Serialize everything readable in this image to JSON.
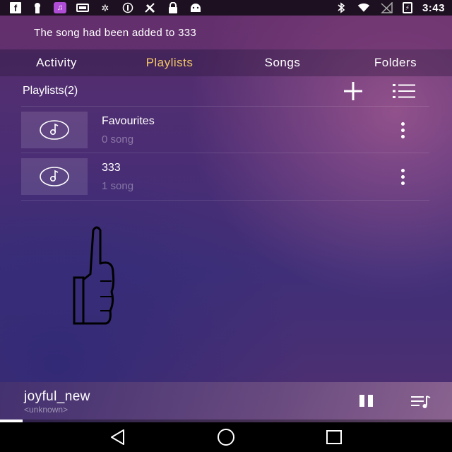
{
  "status_bar": {
    "time": "3:43",
    "left_icons": [
      "facebook-icon",
      "keyhole-icon",
      "music-app-icon",
      "sim-icon",
      "fan-icon",
      "data-saver-icon",
      "no-network-icon",
      "lock-icon",
      "android-icon"
    ],
    "right_icons": [
      "bluetooth-icon",
      "wifi-icon",
      "no-sim-icon",
      "battery-charging-icon"
    ]
  },
  "toast": {
    "message": "The song had been added to 333"
  },
  "tabs": [
    {
      "label": "Activity",
      "active": false
    },
    {
      "label": "Playlists",
      "active": true
    },
    {
      "label": "Songs",
      "active": false
    },
    {
      "label": "Folders",
      "active": false
    }
  ],
  "playlists_header": {
    "title": "Playlists(2)",
    "add_icon": "plus-icon",
    "list_icon": "list-icon"
  },
  "playlists": [
    {
      "name": "Favourites",
      "count": "0 song",
      "icon": "music-disc-icon"
    },
    {
      "name": "333",
      "count": "1 song",
      "icon": "music-disc-icon"
    }
  ],
  "now_playing": {
    "title": "joyful_new",
    "artist": "<unknown>",
    "progress_fraction": 0.05
  },
  "colors": {
    "accent": "#f2c765",
    "status_bar": "#1d1020",
    "nav_bar": "#000000"
  }
}
